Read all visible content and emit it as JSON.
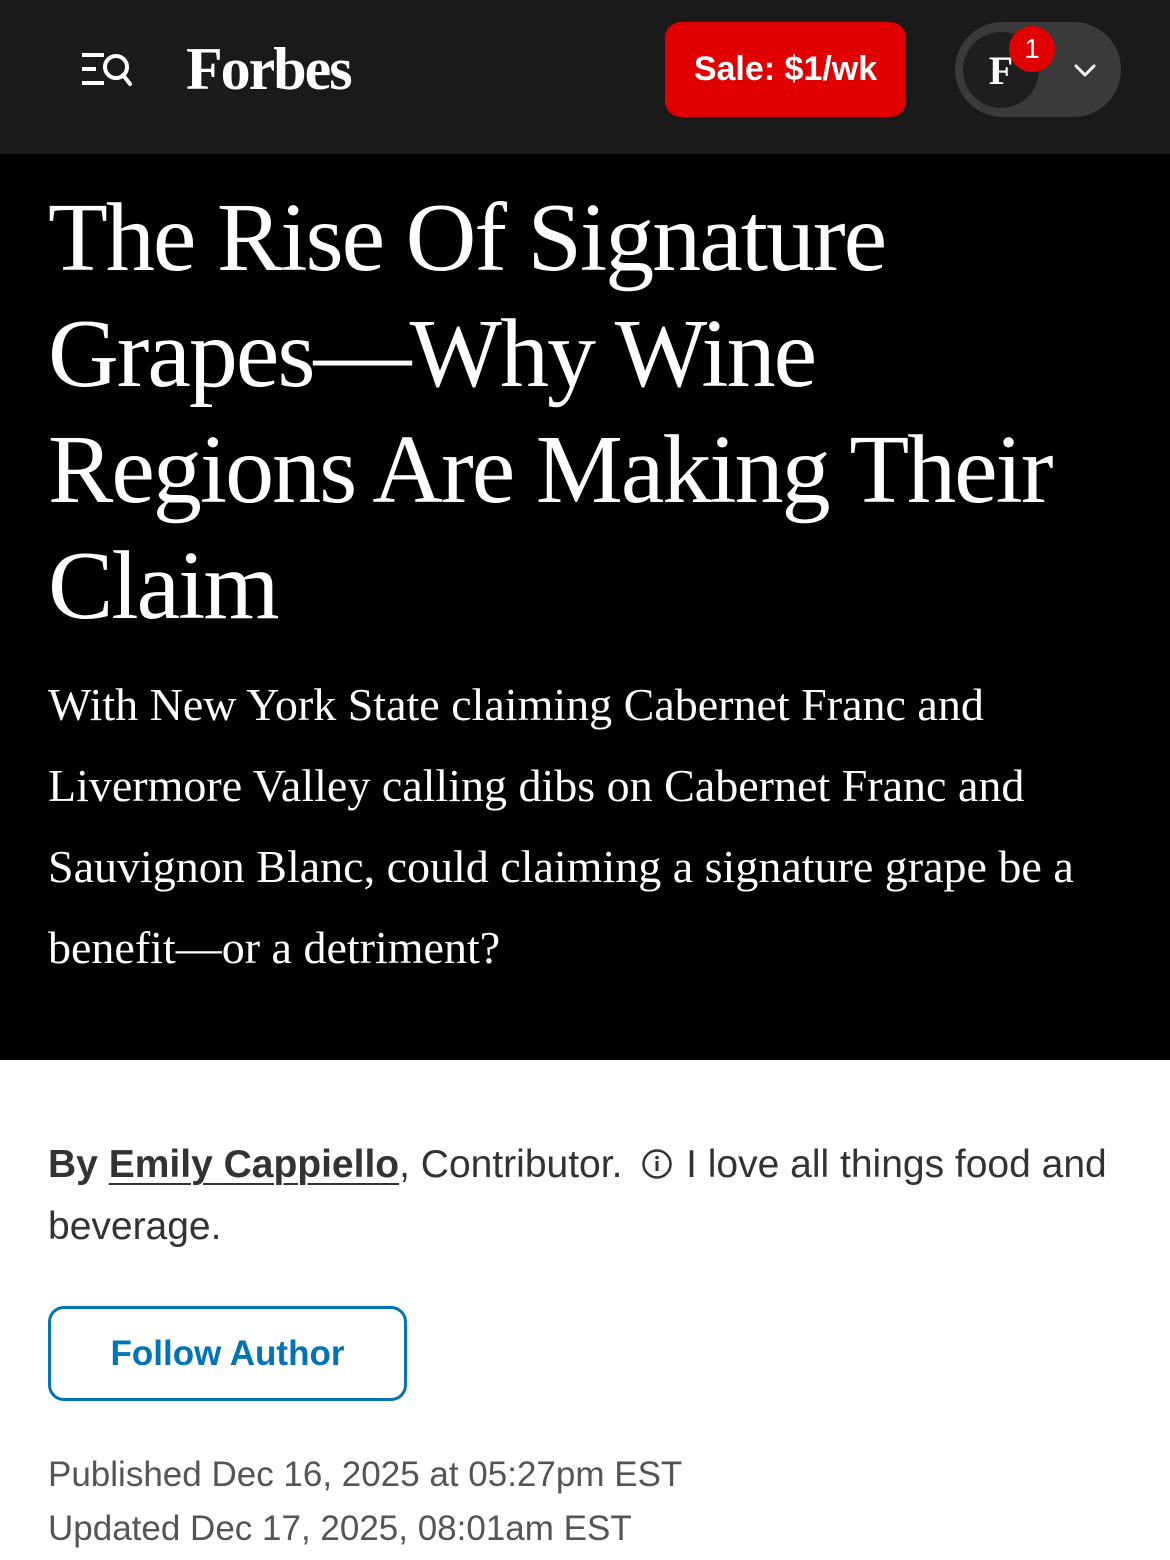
{
  "header": {
    "logo_text": "Forbes",
    "menu_search_icon": "menu-search-icon",
    "sale_label": "Sale: $1/wk",
    "account": {
      "avatar_letter": "F",
      "notification_count": "1",
      "dropdown_icon": "chevron-down-icon"
    }
  },
  "article": {
    "headline": "The Rise Of Signature Grapes—Why Wine Regions Are Making Their Claim",
    "dek": "With New York State claiming Cabernet Franc and Livermore Valley calling dibs on Cabernet Franc and Sauvignon Blanc, could claiming a signature grape be a benefit—or a detriment?",
    "byline": {
      "prefix": "By",
      "author": "Emily Cappiello",
      "separator": ",",
      "role": "Contributor.",
      "bio_icon": "info-icon",
      "bio": "I love all things food and beverage."
    },
    "follow_label": "Follow Author",
    "published": "Published Dec 16, 2025 at 05:27pm EST",
    "updated": "Updated Dec 17, 2025, 08:01am EST"
  },
  "colors": {
    "header_bg": "#1a1a1a",
    "hero_bg": "#000000",
    "sale_red": "#e00000",
    "follow_blue": "#0074b7"
  }
}
